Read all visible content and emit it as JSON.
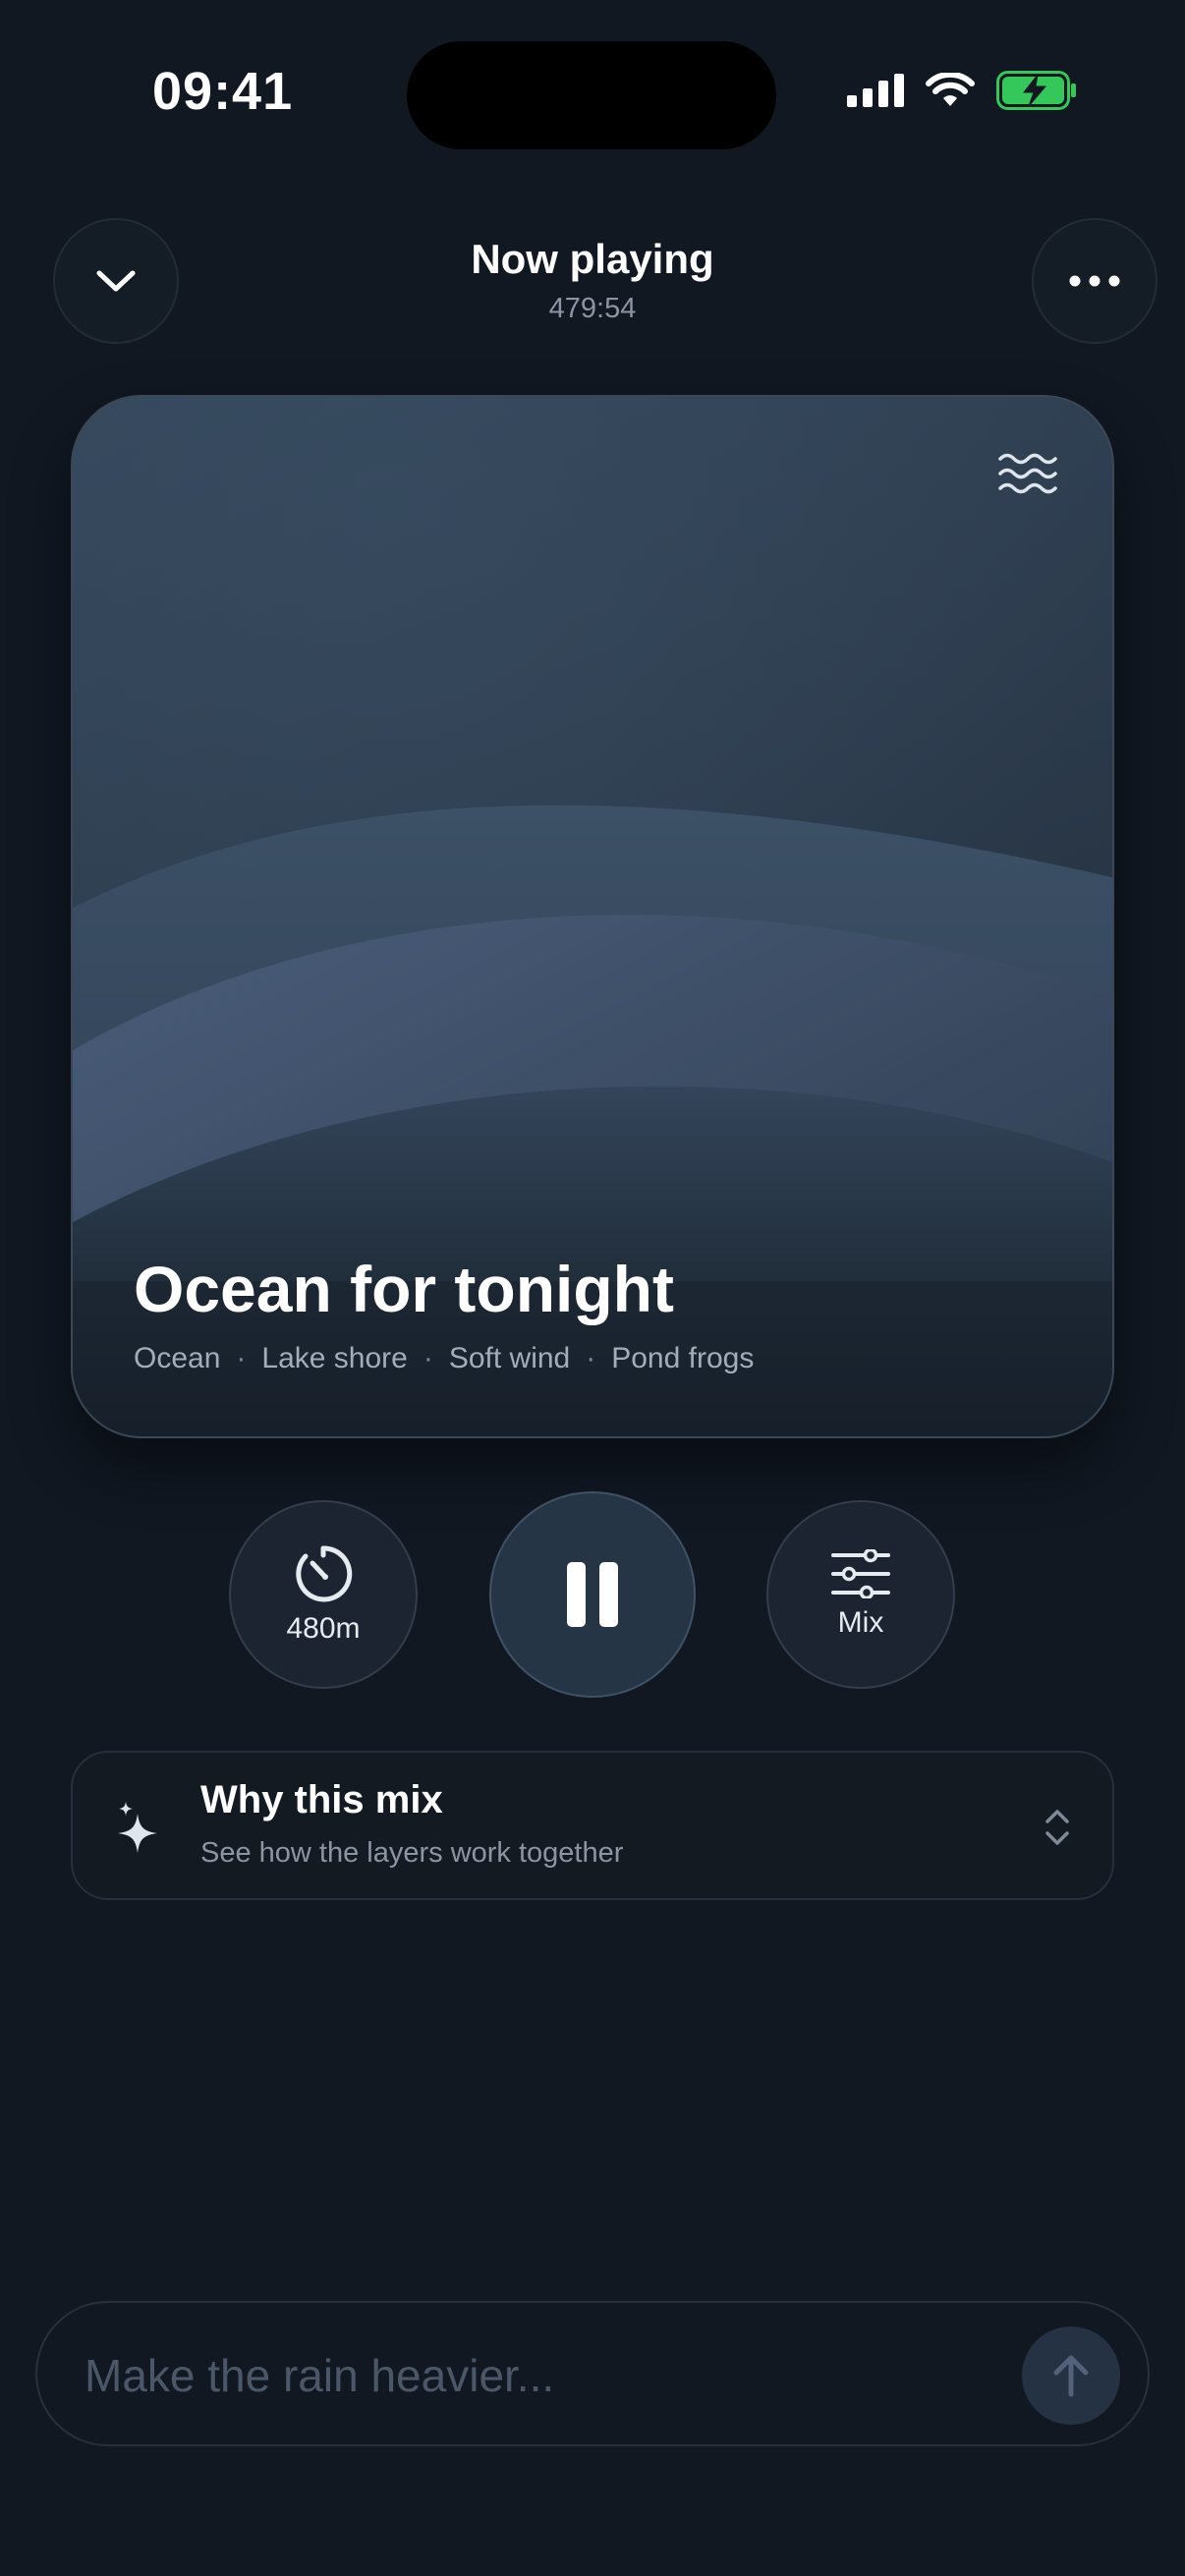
{
  "status_bar": {
    "time": "09:41"
  },
  "header": {
    "collapse_icon": "chevron-down-icon",
    "more_icon": "more-horizontal-icon",
    "title": "Now playing",
    "remaining_time": "479:54"
  },
  "hero": {
    "title": "Ocean for tonight",
    "tags": [
      "Ocean",
      "Lake shore",
      "Soft wind",
      "Pond frogs"
    ],
    "separator": "·",
    "icon": "waves-icon"
  },
  "controls": {
    "timer_label": "480m",
    "timer_icon": "timer-icon",
    "play_state": "playing",
    "play_icon": "pause-icon",
    "mix_label": "Mix",
    "mix_icon": "sliders-icon"
  },
  "why_mix": {
    "title": "Why this mix",
    "subtitle": "See how the layers work together",
    "icon": "sparkle-icon",
    "expand_icon": "chevron-up-down-icon"
  },
  "prompt": {
    "placeholder": "Make the rain heavier...",
    "value": "",
    "send_icon": "arrow-up-icon"
  },
  "colors": {
    "background": "#111822",
    "card_top": "#34475b",
    "accent_button": "#253546",
    "battery_green": "#34c759"
  }
}
